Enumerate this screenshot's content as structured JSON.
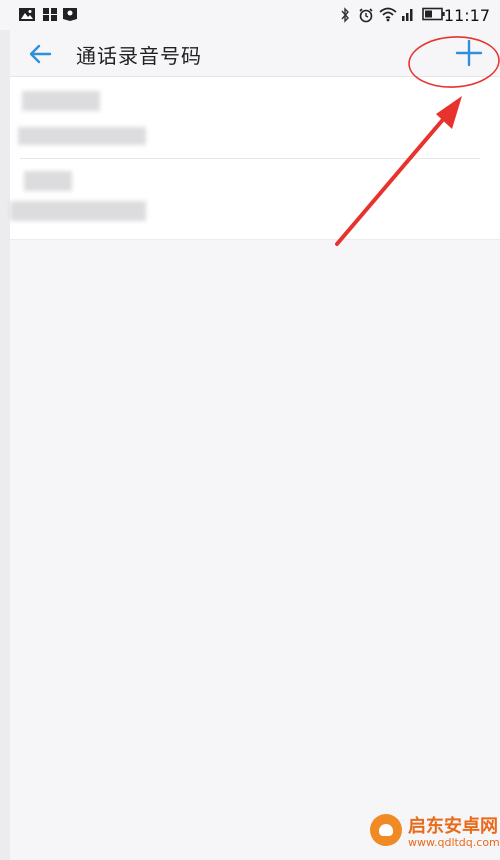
{
  "status_bar": {
    "time": "11:17",
    "left_icons": [
      "image-icon",
      "apps-grid-icon",
      "photo-badge-icon"
    ],
    "right_icons": [
      "bluetooth-icon",
      "alarm-icon",
      "wifi-icon",
      "signal-icon",
      "battery-icon"
    ]
  },
  "header": {
    "title": "通话录音号码",
    "back_icon": "back-arrow-icon",
    "add_icon": "plus-icon"
  },
  "list": {
    "items": [
      {
        "name": "",
        "number": ""
      },
      {
        "name": "",
        "number": ""
      }
    ]
  },
  "annotation": {
    "color": "#e8322d",
    "target": "add-button"
  },
  "watermark": {
    "title": "启东安卓网",
    "url": "www.qdltdq.com"
  },
  "colors": {
    "accent": "#2f8fd8",
    "background": "#f6f6f8",
    "annotation_red": "#e8322d",
    "watermark_orange": "#e86a1a"
  }
}
